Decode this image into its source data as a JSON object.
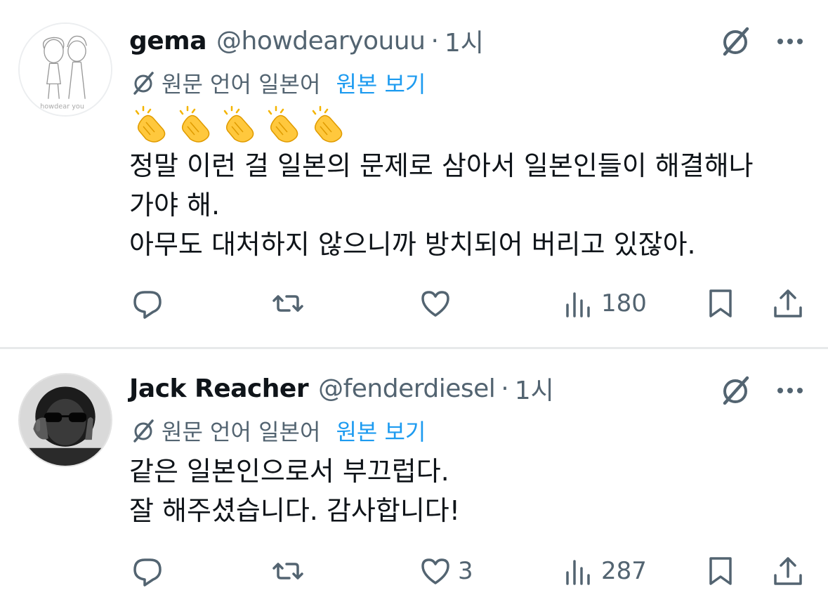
{
  "colors": {
    "text_primary": "#0f1419",
    "text_secondary": "#536471",
    "link": "#1d9bf0",
    "divider": "#e7e9ea"
  },
  "tweets": [
    {
      "name": "gema",
      "handle": "@howdearyouuu",
      "separator": "·",
      "time": "1시",
      "translation": {
        "note": "원문 언어 일본어",
        "link": "원본 보기"
      },
      "emoji": [
        "clapping-hands",
        "clapping-hands",
        "clapping-hands",
        "clapping-hands",
        "clapping-hands"
      ],
      "lines": [
        "정말 이런 걸 일본의 문제로 삼아서 일본인들이 해결해나",
        "가야 해.",
        "아무도 대처하지 않으니까 방치되어 버리고 있잖아."
      ],
      "actions": {
        "replies": "",
        "retweets": "",
        "likes": "",
        "views": "180"
      }
    },
    {
      "name": "Jack Reacher",
      "handle": "@fenderdiesel",
      "separator": "·",
      "time": "1시",
      "translation": {
        "note": "원문 언어 일본어",
        "link": "원본 보기"
      },
      "lines": [
        "같은 일본인으로서 부끄럽다.",
        "잘 해주셨습니다. 감사합니다!"
      ],
      "actions": {
        "replies": "",
        "retweets": "",
        "likes": "3",
        "views": "287"
      }
    }
  ],
  "icons": {
    "grok": "grok-icon",
    "more": "more-icon",
    "translate": "translate-icon",
    "reply": "reply-icon",
    "retweet": "retweet-icon",
    "like": "heart-icon",
    "views": "views-icon",
    "bookmark": "bookmark-icon",
    "share": "share-icon"
  }
}
